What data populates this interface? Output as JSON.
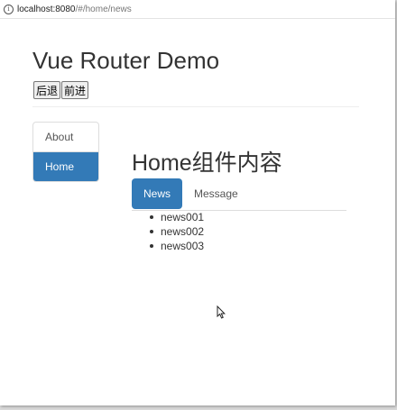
{
  "browser": {
    "url_host": "localhost:8080",
    "url_path": "/#/home/news",
    "info_icon": "info-icon"
  },
  "page": {
    "title": "Vue Router Demo",
    "back_label": "后退",
    "forward_label": "前进"
  },
  "sidebar": {
    "items": [
      {
        "label": "About",
        "active": false
      },
      {
        "label": "Home",
        "active": true
      }
    ]
  },
  "home": {
    "title": "Home组件内容",
    "tabs": [
      {
        "label": "News",
        "active": true
      },
      {
        "label": "Message",
        "active": false
      }
    ],
    "news": [
      "news001",
      "news002",
      "news003"
    ]
  },
  "colors": {
    "accent": "#337ab7",
    "border": "#dddddd"
  }
}
